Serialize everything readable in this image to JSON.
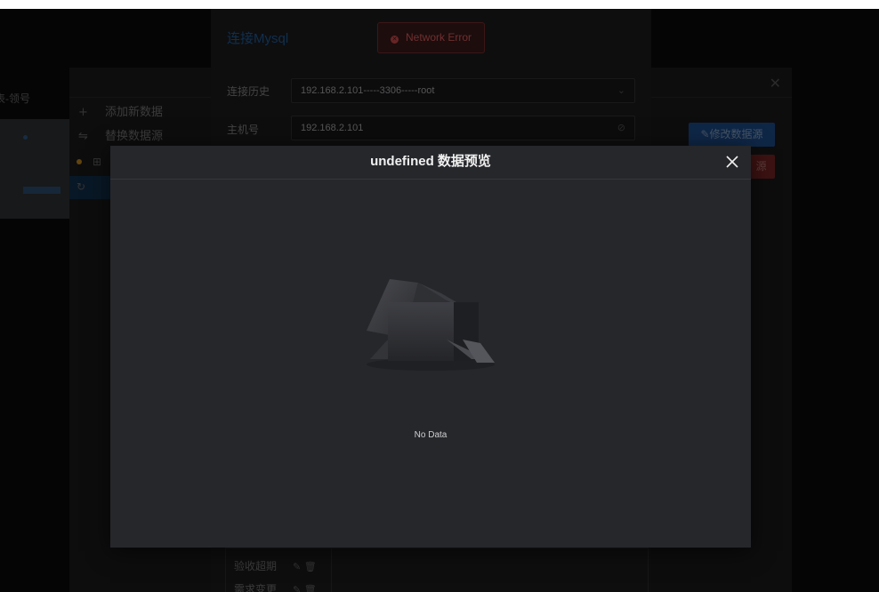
{
  "background_panel": {
    "left_title": "表-领号",
    "menu": [
      {
        "icon": "plus-icon",
        "glyph": "+",
        "label": "添加新数据"
      },
      {
        "icon": "swap-icon",
        "glyph": "⇋",
        "label": "替换数据源"
      }
    ],
    "edit_button_label": "修改数据源",
    "delete_button_label": "源"
  },
  "mysql_dialog": {
    "title": "连接Mysql",
    "error_message": "Network Error",
    "history_label": "连接历史",
    "history_value": "192.168.2.101-----3306-----root",
    "host_label": "主机号",
    "host_value": "192.168.2.101",
    "table_items": [
      {
        "label": "验收超期"
      },
      {
        "label": "需求变更"
      }
    ]
  },
  "preview_modal": {
    "title": "undefined 数据预览",
    "empty_text": "No Data"
  },
  "colors": {
    "accent_blue": "#215e9c",
    "error_red": "#e05d5d",
    "modal_bg": "#26272b"
  }
}
